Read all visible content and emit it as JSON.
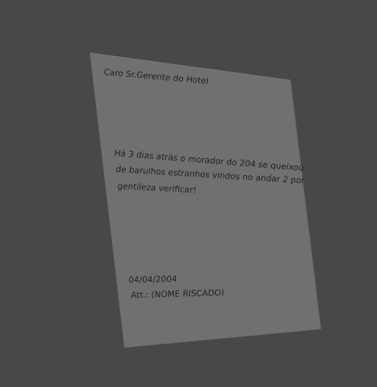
{
  "note": {
    "greeting": "Caro Sr.Gerente do Hotel",
    "body_lines": [
      "Há 3 dias atrás o morador do 204 se queixou",
      "de barulhos estranhos vindos no andar 2 por",
      "gentileza verificar!"
    ],
    "date": "04/04/2004",
    "signature": "Att.: (NOME RISCADO)"
  },
  "colors": {
    "background": "#484848",
    "paper": "#6f716e",
    "ink": "#1f211f"
  }
}
